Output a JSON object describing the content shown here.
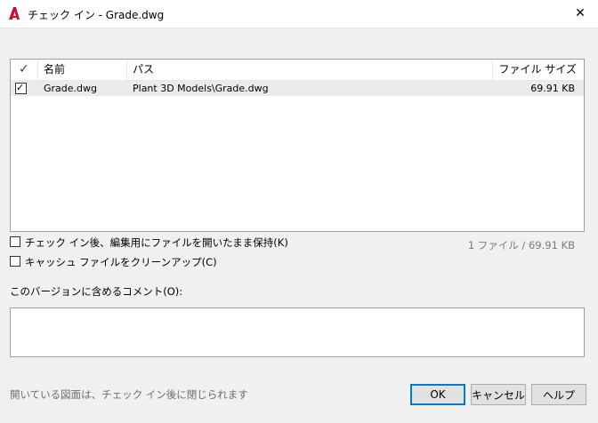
{
  "window": {
    "title": "チェック イン - Grade.dwg",
    "close_glyph": "✕"
  },
  "table": {
    "headers": {
      "check": "✓",
      "name": "名前",
      "path": "パス",
      "size": "ファイル サイズ"
    },
    "rows": [
      {
        "checked": true,
        "check_glyph": "✓",
        "name": "Grade.dwg",
        "path": "Plant 3D Models\\Grade.dwg",
        "size": "69.91 KB"
      }
    ]
  },
  "options": {
    "keep_open_label": "チェック イン後、編集用にファイルを開いたまま保持(K)",
    "clean_cache_label": "キャッシュ ファイルをクリーンアップ(C)"
  },
  "summary": "1 ファイル / 69.91 KB",
  "comment": {
    "label": "このバージョンに含めるコメント(O):",
    "value": ""
  },
  "footer_note": "開いている図面は、チェック イン後に閉じられます",
  "buttons": {
    "ok": "OK",
    "cancel": "キャンセル",
    "help": "ヘルプ"
  },
  "colors": {
    "accent": "#0078d7",
    "app_icon": "#c8102e",
    "header_check": "#1f3a93"
  },
  "icons": {
    "app": "autocad-logo-icon",
    "close": "close-icon",
    "header_check": "checkmark-icon",
    "row_check": "checkbox-checked-icon"
  }
}
